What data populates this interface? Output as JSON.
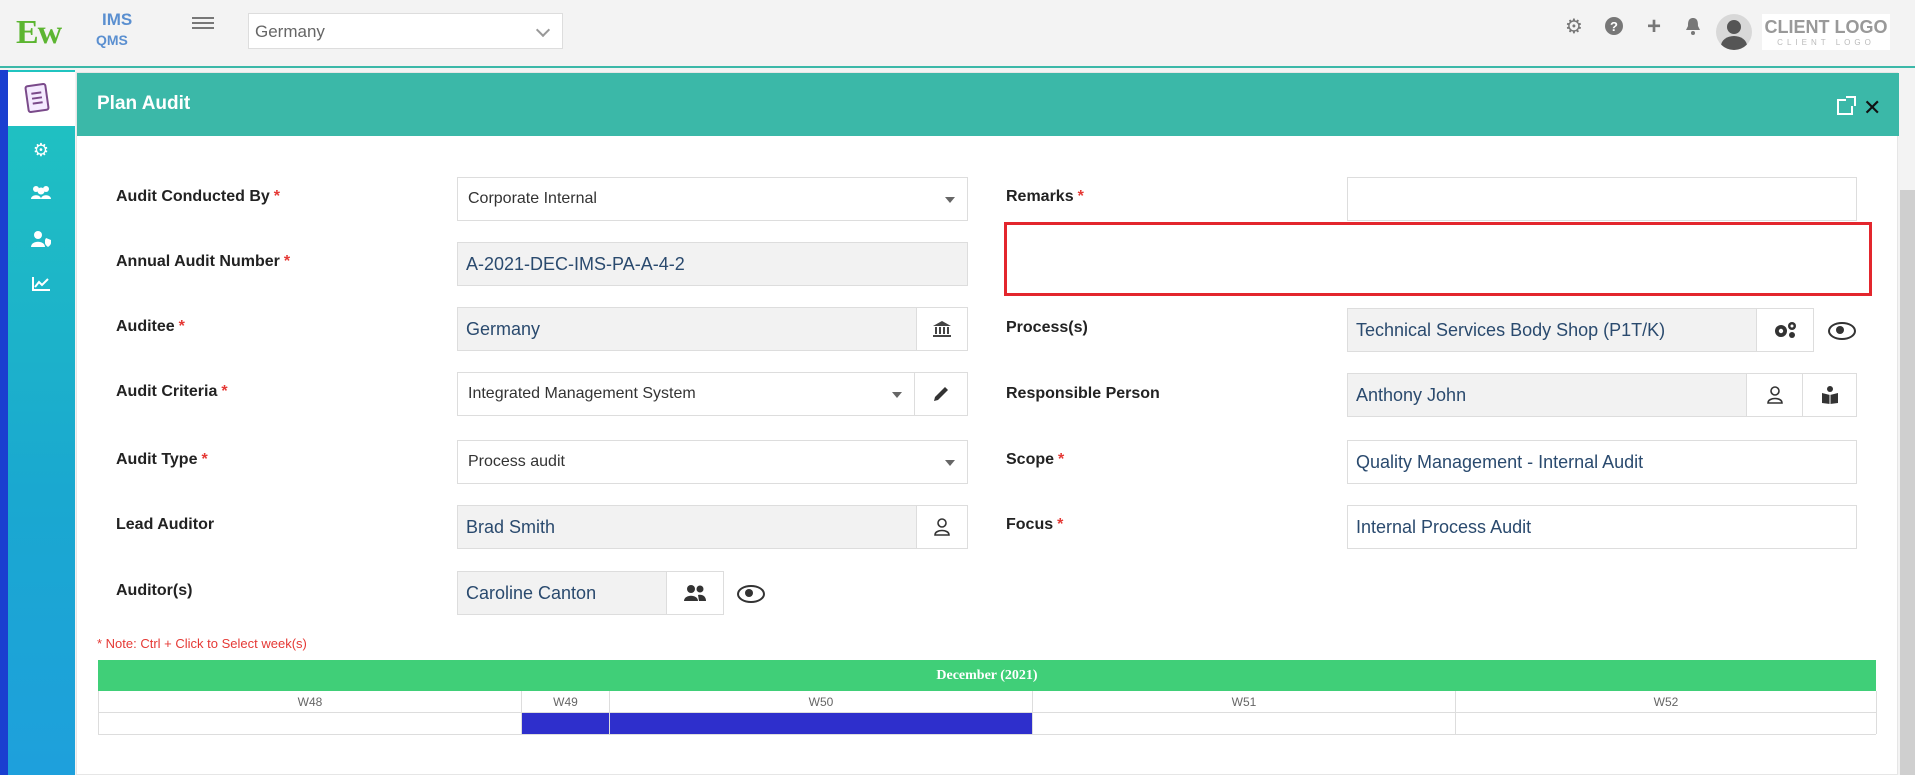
{
  "topbar": {
    "logo_ew": "Ew",
    "logo_ims": "IMS",
    "logo_qms": "QMS",
    "country": "Germany",
    "client_logo_line1": "CLIENT LOGO",
    "client_logo_line2": "CLIENT LOGO"
  },
  "panel": {
    "title": "Plan Audit"
  },
  "form": {
    "audit_conducted_by_label": "Audit Conducted By",
    "audit_conducted_by_value": "Corporate Internal",
    "annual_audit_number_label": "Annual Audit Number",
    "annual_audit_number_value": "A-2021-DEC-IMS-PA-A-4-2",
    "auditee_label": "Auditee",
    "auditee_value": "Germany",
    "audit_criteria_label": "Audit Criteria",
    "audit_criteria_value": "Integrated Management System",
    "audit_type_label": "Audit Type",
    "audit_type_value": "Process audit",
    "lead_auditor_label": "Lead Auditor",
    "lead_auditor_value": "Brad Smith",
    "auditors_label": "Auditor(s)",
    "auditors_value": "Caroline Canton",
    "remarks_label": "Remarks",
    "remarks_value": "",
    "processes_label": "Process(s)",
    "processes_value": "Technical Services Body Shop (P1T/K)",
    "responsible_person_label": "Responsible Person",
    "responsible_person_value": "Anthony John",
    "scope_label": "Scope",
    "scope_value": "Quality Management - Internal Audit",
    "focus_label": "Focus",
    "focus_value": "Internal Process Audit",
    "required_mark": "*"
  },
  "calendar": {
    "note": "* Note: Ctrl + Click to Select week(s)",
    "month": "December (2021)",
    "weeks": [
      "W48",
      "W49",
      "W50",
      "W51",
      "W52"
    ],
    "selected_weeks": [
      "W49",
      "W50"
    ],
    "selected_color": "#2e2fcc",
    "header_color": "#40cf78"
  },
  "colors": {
    "panel_header": "#3bb8a8",
    "required": "#e53935",
    "highlight_box": "#e3262d"
  },
  "icons": {
    "hamburger": "menu-icon",
    "settings": "gear-icon",
    "help": "question-icon",
    "add": "plus-icon",
    "notifications": "bell-icon",
    "sidebar": [
      "document-icon",
      "gear-icon",
      "users-gear-icon",
      "user-shield-icon",
      "chart-icon"
    ]
  }
}
